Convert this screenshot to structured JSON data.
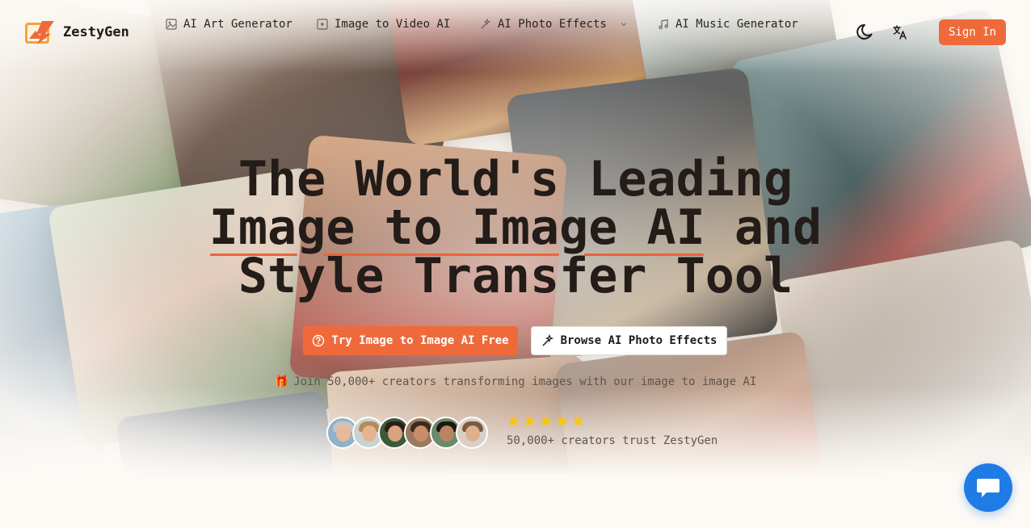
{
  "brand": {
    "name": "ZestyGen",
    "accent": "#ef6a3b"
  },
  "nav": {
    "items": [
      {
        "label": "AI Art Generator",
        "icon": "image-icon"
      },
      {
        "label": "Image to Video AI",
        "icon": "video-icon"
      },
      {
        "label": "AI Photo Effects",
        "icon": "magic-wand-icon",
        "has_dropdown": true
      },
      {
        "label": "AI Music Generator",
        "icon": "music-note-icon"
      }
    ],
    "sign_in": "Sign In"
  },
  "hero": {
    "title_lines": [
      "The World's Leading",
      "Image to Image AI and",
      "Style Transfer Tool"
    ],
    "cta_primary": "Try Image to Image AI Free",
    "cta_secondary": "Browse AI Photo Effects",
    "join_text": "Join 50,000+ creators transforming images with our image to image AI",
    "rating_stars": 5,
    "trust_text": "50,000+ creators trust ZestyGen"
  },
  "colors": {
    "accent": "#ef6a3b",
    "chat": "#1f7be6",
    "star": "#f5c518"
  }
}
